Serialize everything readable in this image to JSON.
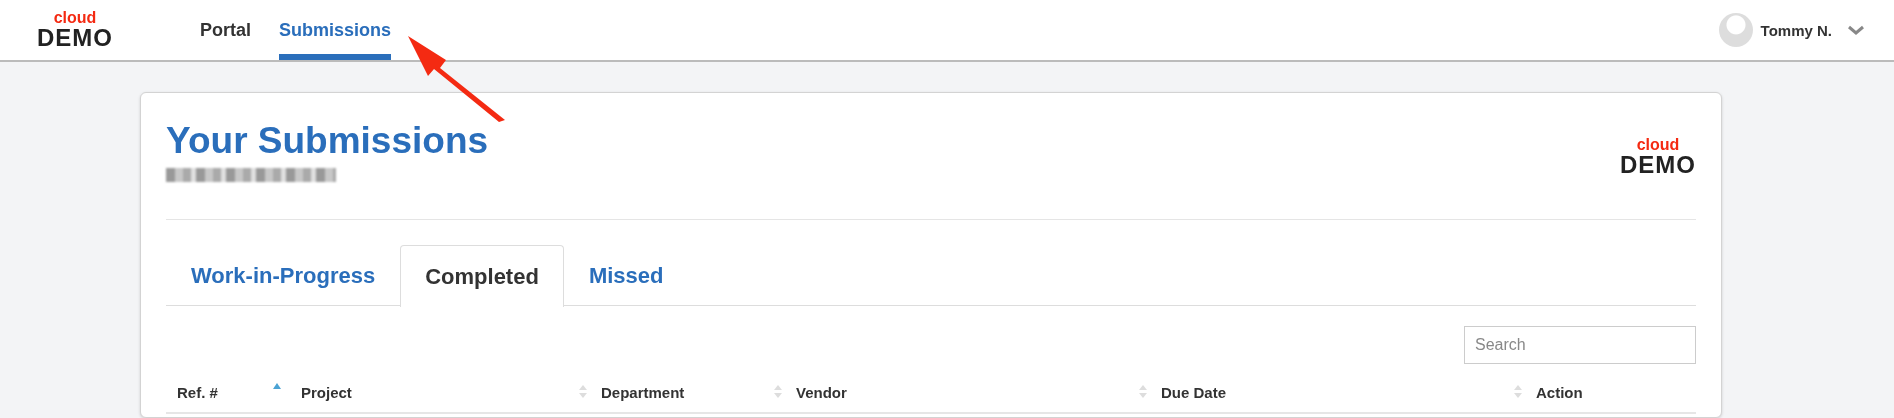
{
  "header": {
    "logo": {
      "top": "cloud",
      "bottom": "DEMO"
    },
    "nav": [
      {
        "label": "Portal",
        "selected": false
      },
      {
        "label": "Submissions",
        "selected": true
      }
    ],
    "user": {
      "name": "Tommy N."
    }
  },
  "card": {
    "title": "Your Submissions",
    "logo": {
      "top": "cloud",
      "bottom": "DEMO"
    },
    "tabs": [
      {
        "label": "Work-in-Progress",
        "selected": false
      },
      {
        "label": "Completed",
        "selected": true
      },
      {
        "label": "Missed",
        "selected": false
      }
    ],
    "search": {
      "placeholder": "Search"
    },
    "table": {
      "columns": [
        {
          "label": "Ref. #",
          "sortable": true,
          "sorted": true
        },
        {
          "label": "Project",
          "sortable": true,
          "sorted": false
        },
        {
          "label": "Department",
          "sortable": true,
          "sorted": false
        },
        {
          "label": "Vendor",
          "sortable": true,
          "sorted": false
        },
        {
          "label": "Due Date",
          "sortable": true,
          "sorted": false
        },
        {
          "label": "Action",
          "sortable": false
        }
      ]
    }
  }
}
